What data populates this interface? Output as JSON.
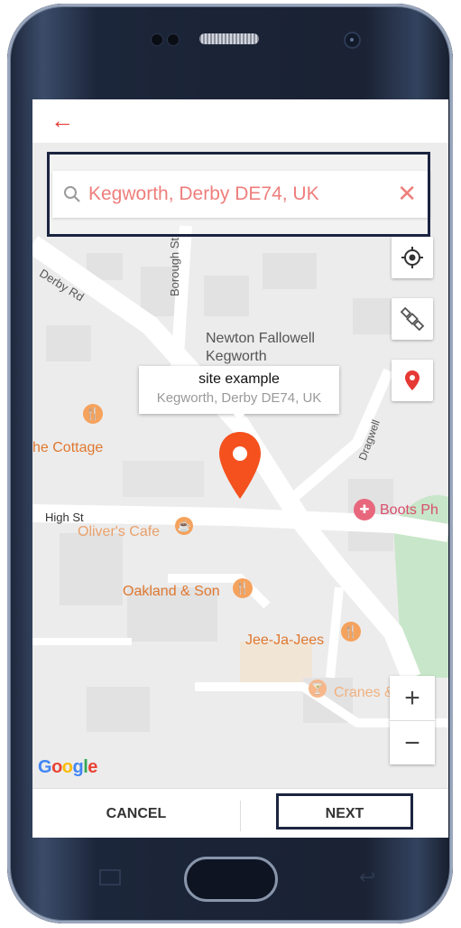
{
  "topbar": {
    "back_label": "←"
  },
  "search": {
    "value": "Kegworth, Derby DE74, UK",
    "clear_label": "✕"
  },
  "map": {
    "street_labels": [
      "Derby Rd",
      "Borough St",
      "High St",
      "Dragwell"
    ],
    "places": [
      "Newton Fallowell",
      "Kegworth"
    ],
    "pois": [
      "he Cottage",
      "Oliver's Cafe",
      "Oakland & Son",
      "Jee-Ja-Jees",
      "Cranes & Wells",
      "Boots Ph"
    ],
    "callout": {
      "title": "site example",
      "subtitle": "Kegworth, Derby DE74, UK"
    },
    "zoom_in": "+",
    "zoom_out": "−",
    "attribution": "Google"
  },
  "footer": {
    "cancel_label": "CANCEL",
    "next_label": "NEXT"
  },
  "colors": {
    "accent": "#e53935",
    "poi": "#e0782f",
    "map_bg": "#ececec",
    "road": "#ffffff",
    "park": "#c8e6c9"
  }
}
